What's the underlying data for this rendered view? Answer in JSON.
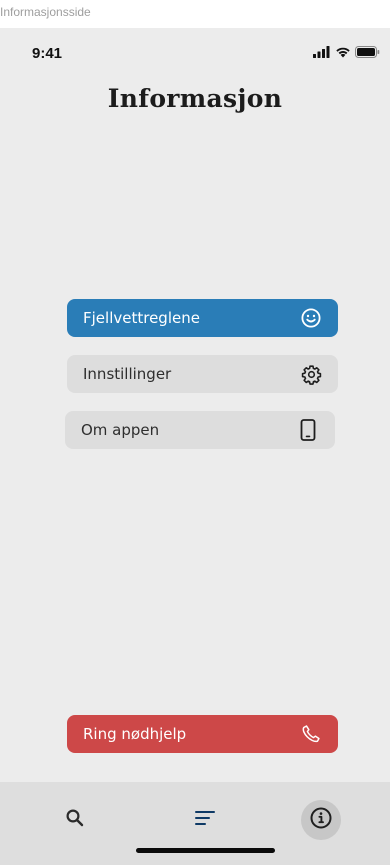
{
  "canvas_label": "Informasjonsside",
  "status_bar": {
    "time": "9:41",
    "icons": [
      "signal-icon",
      "wifi-icon",
      "battery-icon"
    ]
  },
  "page": {
    "title": "Informasjon"
  },
  "menu": {
    "items": [
      {
        "label": "Fjellvettreglene",
        "icon": "smiley-icon",
        "color": "#2a7db7",
        "active": true
      },
      {
        "label": "Innstillinger",
        "icon": "gear-icon",
        "color": "#dddddd",
        "active": false
      },
      {
        "label": "Om appen",
        "icon": "phone-device-icon",
        "color": "#dddddd",
        "active": false
      }
    ]
  },
  "emergency": {
    "label": "Ring nødhjelp",
    "icon": "phone-call-icon",
    "color": "#cd4848"
  },
  "tab_bar": {
    "tabs": [
      {
        "name": "search",
        "icon": "search-icon",
        "selected": false
      },
      {
        "name": "list",
        "icon": "menu-lines-icon",
        "selected": false
      },
      {
        "name": "info",
        "icon": "info-icon",
        "selected": true
      }
    ]
  },
  "colors": {
    "background": "#ececec",
    "tab_bar": "#dedede",
    "accent_blue": "#2a7db7",
    "danger_red": "#cd4848"
  }
}
